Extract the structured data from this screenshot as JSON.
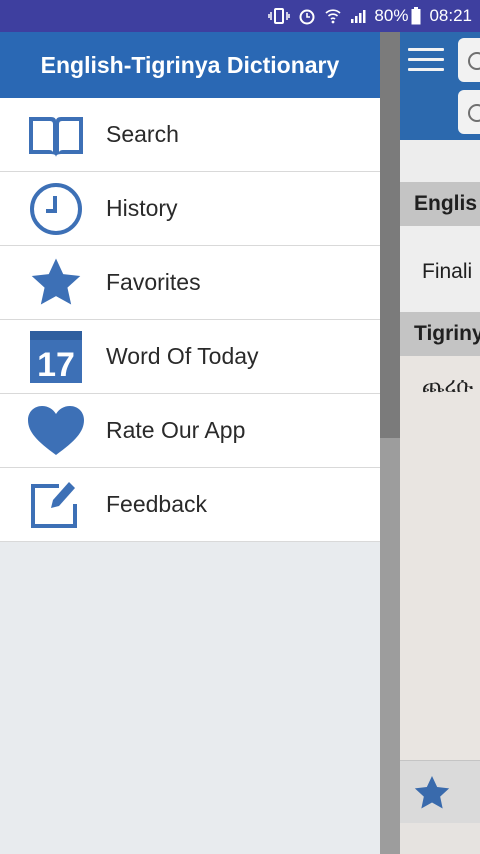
{
  "status_bar": {
    "battery": "80%",
    "time": "08:21",
    "icons": [
      "vibrate-icon",
      "alarm-icon",
      "wifi-icon",
      "signal-icon",
      "battery-icon"
    ]
  },
  "drawer": {
    "title": "English-Tigrinya Dictionary",
    "items": [
      {
        "label": "Search",
        "icon": "book-icon"
      },
      {
        "label": "History",
        "icon": "clock-icon"
      },
      {
        "label": "Favorites",
        "icon": "star-icon"
      },
      {
        "label": "Word Of Today",
        "icon": "calendar-icon",
        "icon_text": "17"
      },
      {
        "label": "Rate Our App",
        "icon": "heart-icon"
      },
      {
        "label": "Feedback",
        "icon": "edit-icon"
      }
    ]
  },
  "main": {
    "english_header": "Englis",
    "english_word": "Finali",
    "tigrinya_header": "Tigriny",
    "tigrinya_word": "ጨረሱ"
  },
  "colors": {
    "status_bar": "#3e3f9f",
    "brand_blue": "#2a68b4",
    "icon_blue": "#3d70b6"
  }
}
